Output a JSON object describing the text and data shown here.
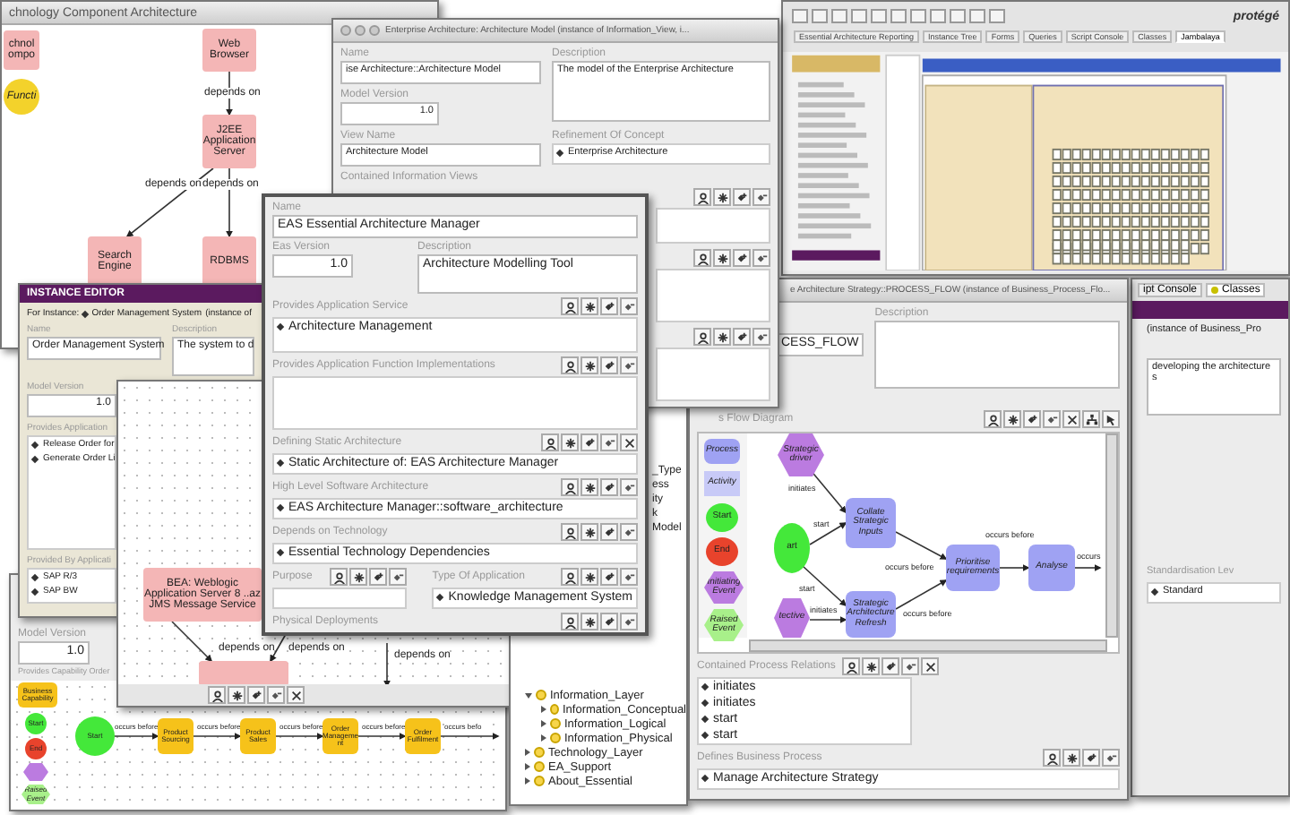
{
  "protege_window": {
    "logo": "protégé",
    "tabs": [
      {
        "label": "Essential Architecture Reporting",
        "selected": false
      },
      {
        "label": "Instance Tree",
        "selected": false
      },
      {
        "label": "Forms",
        "selected": false
      },
      {
        "label": "Queries",
        "selected": false
      },
      {
        "label": "Script Console",
        "selected": false
      },
      {
        "label": "Classes",
        "selected": false
      },
      {
        "label": "Jambalaya",
        "selected": true
      }
    ]
  },
  "technology_window": {
    "title": "chnology Component Architecture",
    "palette": [
      {
        "kind": "component",
        "label": "chnol ompo"
      },
      {
        "kind": "function",
        "label": "Functi"
      }
    ],
    "nodes": [
      {
        "kind": "component",
        "label": "Web Browser"
      },
      {
        "kind": "component",
        "label": "J2EE Application Server"
      },
      {
        "kind": "component",
        "label": "Search Engine"
      },
      {
        "kind": "component",
        "label": "RDBMS"
      }
    ],
    "edges": [
      {
        "label": "depends on"
      },
      {
        "label": "depends on"
      },
      {
        "label": "depends on"
      }
    ]
  },
  "model_window": {
    "title": "Enterprise Architecture: Architecture Model   (instance of Information_View, i...",
    "name": {
      "label": "Name",
      "value": "ise Architecture::Architecture Model"
    },
    "description": {
      "label": "Description",
      "value": "The model of the Enterprise Architecture"
    },
    "model_version": {
      "label": "Model Version",
      "value": "1.0"
    },
    "view_name": {
      "label": "View Name",
      "value": "Architecture Model"
    },
    "refinement": {
      "label": "Refinement Of Concept",
      "items": [
        "Enterprise Architecture"
      ]
    },
    "contained_views": {
      "label": "Contained Information Views"
    }
  },
  "capability_window": {
    "model_version": {
      "label": "Model Version",
      "value": "1.0"
    },
    "diagram_label": "Provides Capability Order",
    "palette": [
      {
        "kind": "capability",
        "label": "Business Capability"
      },
      {
        "kind": "start",
        "label": "Start"
      },
      {
        "kind": "end",
        "label": "End"
      },
      {
        "kind": "event"
      },
      {
        "kind": "raised",
        "label": "Raised Event"
      }
    ],
    "nodes": [
      {
        "kind": "start",
        "label": "Start"
      },
      {
        "kind": "capability",
        "label": "Product Sourcing"
      },
      {
        "kind": "capability",
        "label": "Product Sales"
      },
      {
        "kind": "capability",
        "label": "Order Management"
      },
      {
        "kind": "capability",
        "label": "Order Fulfilment"
      }
    ],
    "edges": [
      {
        "label": "occurs before"
      },
      {
        "label": "occurs before"
      },
      {
        "label": "occurs before"
      },
      {
        "label": "occurs before"
      },
      {
        "label": "occurs befo"
      }
    ]
  },
  "order_window": {
    "title": "INSTANCE EDITOR",
    "for_label": "For Instance:",
    "instance": "Order Management System",
    "instance_of": "(instance of",
    "name": {
      "label": "Name",
      "value": "Order Management System"
    },
    "description": {
      "label": "Description",
      "value": "The system to d"
    },
    "model_version": {
      "label": "Model Version",
      "value": "1.0"
    },
    "lists": [
      {
        "label": "Provides Application",
        "items": [
          "Release Order for",
          "Generate Order Li"
        ]
      },
      {
        "label": "Provided By Applicati",
        "items": [
          "SAP R/3",
          "SAP BW"
        ]
      }
    ]
  },
  "deployment_window": {
    "nodes": [
      {
        "kind": "component",
        "label": "BEA: Weblogic Application Server 8 ..az JMS Message Service"
      },
      {
        "kind": "component"
      }
    ],
    "edges": [
      {
        "label": "depends on"
      },
      {
        "label": "depends on"
      },
      {
        "label": "depends on"
      }
    ]
  },
  "tree_panel": {
    "fragments": [
      "_Type",
      "ess",
      "ity",
      "k",
      "Model"
    ],
    "items": [
      {
        "label": "Information_Layer",
        "expanded": true,
        "children": [
          {
            "label": "Information_Conceptual",
            "expanded": false
          },
          {
            "label": "Information_Logical",
            "expanded": false
          },
          {
            "label": "Information_Physical",
            "expanded": false
          }
        ]
      },
      {
        "label": "Technology_Layer",
        "expanded": false
      },
      {
        "label": "EA_Support",
        "expanded": false
      },
      {
        "label": "About_Essential",
        "expanded": false
      }
    ]
  },
  "application_window": {
    "name": {
      "label": "Name",
      "value": "EAS Essential Architecture Manager"
    },
    "version": {
      "label": "Eas Version",
      "value": "1.0"
    },
    "description": {
      "label": "Description",
      "value": "Architecture Modelling Tool"
    },
    "lists": [
      {
        "label": "Provides Application Service",
        "items": [
          "Architecture Management"
        ]
      },
      {
        "label": "Provides Application Function Implementations"
      },
      {
        "label": "Defining Static Architecture",
        "items": [
          "Static Architecture of: EAS Architecture Manager"
        ]
      },
      {
        "label": "High Level Software Architecture",
        "items": [
          "EAS Architecture Manager::software_architecture"
        ]
      },
      {
        "label": "Depends on Technology",
        "items": [
          "Essential Technology Dependencies"
        ]
      }
    ],
    "purpose": {
      "label": "Purpose"
    },
    "type_of_application": {
      "label": "Type Of Application",
      "items": [
        "Knowledge Management System"
      ]
    },
    "physical_deployments": {
      "label": "Physical Deployments"
    }
  },
  "process_window": {
    "title": "e Architecture Strategy::PROCESS_FLOW  (instance of Business_Process_Flo...",
    "name_value": "CESS_FLOW",
    "description_label": "Description",
    "diagram_label": "s Flow Diagram",
    "palette": [
      {
        "kind": "process",
        "label": "Process"
      },
      {
        "kind": "activity",
        "label": "Activity"
      },
      {
        "kind": "start",
        "label": "Start"
      },
      {
        "kind": "end",
        "label": "End"
      },
      {
        "kind": "event",
        "label": "Initiating Event"
      },
      {
        "kind": "raised",
        "label": "Raised Event"
      }
    ],
    "nodes": [
      {
        "kind": "event",
        "label": "Strategic driver"
      },
      {
        "kind": "start",
        "label": "art"
      },
      {
        "kind": "event",
        "label": "tective"
      },
      {
        "kind": "process",
        "label": "Collate Strategic Inputs"
      },
      {
        "kind": "process",
        "label": "Strategic Architecture Refresh"
      },
      {
        "kind": "process",
        "label": "Prioritise requirements"
      },
      {
        "kind": "process",
        "label": "Analyse"
      }
    ],
    "edges": [
      {
        "label": "initiates"
      },
      {
        "label": "start"
      },
      {
        "label": "start"
      },
      {
        "label": "initiates"
      },
      {
        "label": "occurs before"
      },
      {
        "label": "occurs before"
      },
      {
        "label": "occurs before"
      },
      {
        "label": "occurs"
      }
    ],
    "relations": {
      "label": "Contained Process Relations",
      "items": [
        "initiates",
        "initiates",
        "start",
        "start"
      ]
    },
    "defines": {
      "label": "Defines Business Process",
      "items": [
        "Manage Architecture Strategy"
      ]
    }
  },
  "right_window": {
    "tabs": [
      {
        "label": "ipt Console",
        "selected": false
      },
      {
        "label": "Classes",
        "selected": true
      }
    ],
    "instance_of": "(instance of Business_Pro",
    "description": "developing the architecture s",
    "standard": {
      "label": "Standardisation Lev",
      "items": [
        "Standard"
      ]
    }
  }
}
